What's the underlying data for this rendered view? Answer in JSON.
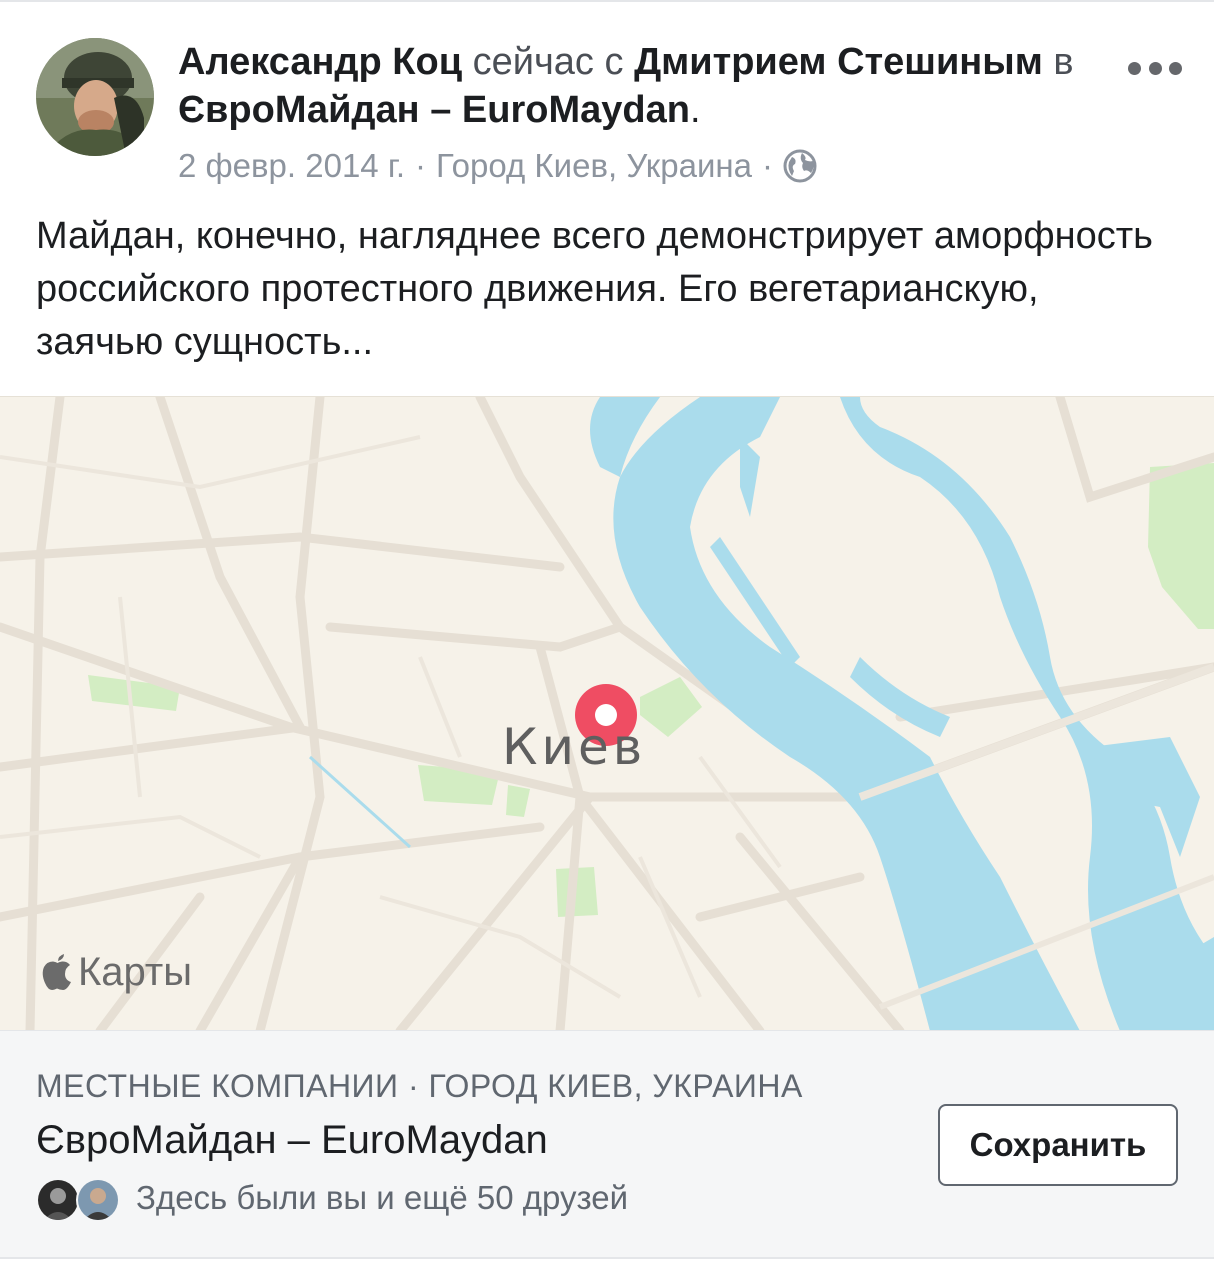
{
  "post": {
    "author": "Александр Коц",
    "connector_now_with": "сейчас с",
    "tagged": "Дмитрием Стешиным",
    "connector_in": "в",
    "place": "ЄвроМайдан – EuroMaydan",
    "period": ".",
    "date": "2 февр. 2014 г.",
    "location": "Город Киев, Украина",
    "separator": "·",
    "privacy_icon": "globe-icon",
    "more_icon": "more-options-icon",
    "text": "Майдан, конечно, нагляднее всего демонстрирует аморфность российского протестного движения. Его вегетарианскую, заячью сущность..."
  },
  "map": {
    "city_label": "Киев",
    "brand_label": "Карты",
    "brand_icon": "apple-logo-icon",
    "pin_icon": "map-pin-icon",
    "colors": {
      "land": "#f6f2e9",
      "water": "#aadcec",
      "park": "#d3edc3",
      "road": "#e6dfd4",
      "pin": "#ef4d63"
    }
  },
  "place_card": {
    "category": "МЕСТНЫЕ КОМПАНИИ · ГОРОД КИЕВ, УКРАИНА",
    "name": "ЄвроМайдан – EuroMaydan",
    "friends_text": "Здесь были вы и ещё 50 друзей",
    "save_label": "Сохранить"
  }
}
